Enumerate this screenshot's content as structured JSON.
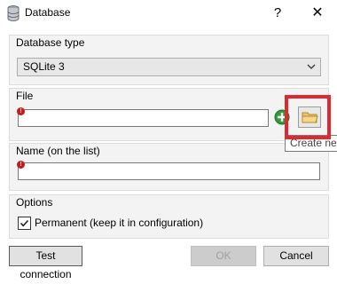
{
  "window": {
    "title": "Database",
    "help": "?",
    "close": "✕"
  },
  "database_type": {
    "group_label": "Database type",
    "selected": "SQLite 3"
  },
  "file": {
    "group_label": "File",
    "value": "",
    "warning": "!"
  },
  "name": {
    "group_label": "Name (on the list)",
    "value": "",
    "warning": "!"
  },
  "options": {
    "group_label": "Options",
    "permanent_label": "Permanent (keep it in configuration)",
    "permanent_checked": true
  },
  "buttons": {
    "test": "Test connection",
    "ok": "OK",
    "cancel": "Cancel"
  },
  "tooltip": {
    "text": "Create new"
  },
  "colors": {
    "highlight": "#e0282e",
    "add_green": "#2e9e3c",
    "warning_red": "#c41d1d"
  }
}
